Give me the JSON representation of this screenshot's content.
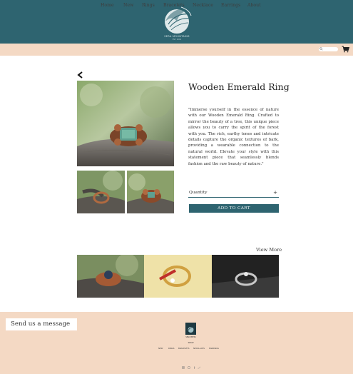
{
  "brand": {
    "name": "SERA MOUNTAINS",
    "tagline": "EST. 2019"
  },
  "nav": {
    "items": [
      "Home",
      "New",
      "Rings",
      "Bracelets",
      "Necklace",
      "Earrings",
      "About"
    ]
  },
  "colors": {
    "header": "#2e6470",
    "nav": "#f4d9c4",
    "button": "#2e6470",
    "footer": "#f4d9c4"
  },
  "product": {
    "title": "Wooden Emerald Ring",
    "description": "\"Immerse yourself in the essence of nature with our Wooden Emerald Ring. Crafted to mirror the beauty of a tree, this unique piece allows you to carry the spirit of the forest with you. The rich, earthy tones and intricate details capture the organic textures of bark, providing a wearable connection to the natural world. Elevate your style with this statement piece that seamlessly blends fashion and the raw beauty of nature.\"",
    "quantity_label": "Quantity",
    "quantity_plus": "+",
    "add_to_cart": "ADD TO CART"
  },
  "related": {
    "view_more": "View More"
  },
  "footer": {
    "send_message": "Send us a message",
    "logo_text": "SERA MNTNS",
    "shop_label": "SHOP",
    "links": [
      "NEW",
      "RINGS",
      "BRACELETS",
      "NECKLACES",
      "EARRINGS"
    ]
  },
  "icons": {
    "search": "search-icon",
    "cart": "cart-icon",
    "back": "chevron-left-icon",
    "social": [
      "instagram-icon",
      "pinterest-icon",
      "facebook-icon",
      "twitter-icon"
    ]
  }
}
